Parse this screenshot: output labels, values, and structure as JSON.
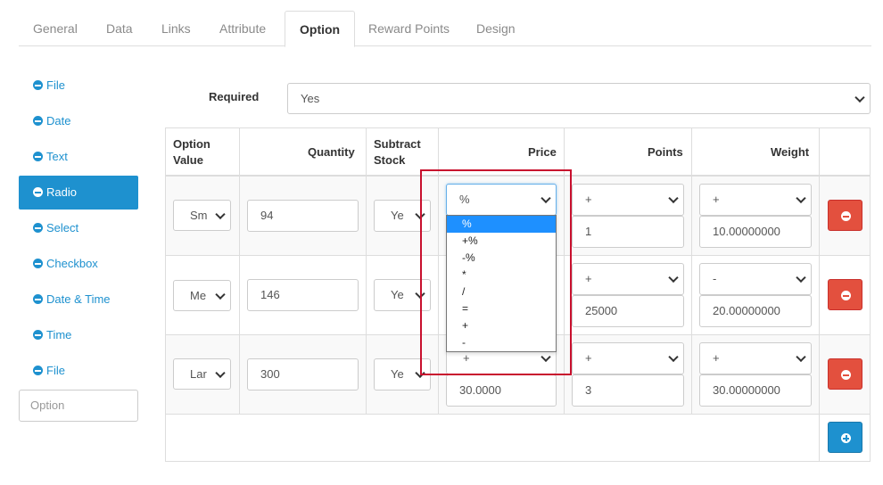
{
  "tabs": [
    "General",
    "Data",
    "Links",
    "Attribute",
    "Option",
    "Reward Points",
    "Design"
  ],
  "sidebar": {
    "items": [
      "File",
      "Date",
      "Text",
      "Radio",
      "Select",
      "Checkbox",
      "Date & Time",
      "Time",
      "File"
    ],
    "input_placeholder": "Option"
  },
  "required": {
    "label": "Required",
    "value": "Yes"
  },
  "table": {
    "headers": {
      "option_value_1": "Option",
      "option_value_2": "Value",
      "quantity": "Quantity",
      "subtract_1": "Subtract",
      "subtract_2": "Stock",
      "price": "Price",
      "points": "Points",
      "weight": "Weight"
    },
    "rows": [
      {
        "option_value": "Sm",
        "quantity": "94",
        "subtract": "Ye",
        "price_prefix": "%",
        "price": "",
        "points_prefix": "+",
        "points": "1",
        "weight_prefix": "+",
        "weight": "10.00000000"
      },
      {
        "option_value": "Me",
        "quantity": "146",
        "subtract": "Ye",
        "price_prefix": "",
        "price": "",
        "points_prefix": "+",
        "points": "25000",
        "weight_prefix": "-",
        "weight": "20.00000000"
      },
      {
        "option_value": "Lar",
        "quantity": "300",
        "subtract": "Ye",
        "price_prefix": "+",
        "price": "30.0000",
        "points_prefix": "+",
        "points": "3",
        "weight_prefix": "+",
        "weight": "30.00000000"
      }
    ]
  },
  "price_dropdown": {
    "options": [
      "%",
      "+%",
      "-%",
      "*",
      "/",
      "=",
      "+",
      "-"
    ],
    "selected": "%"
  },
  "colors": {
    "accent": "#1e91cf",
    "danger": "#e3503e",
    "highlight": "#c8102e"
  }
}
